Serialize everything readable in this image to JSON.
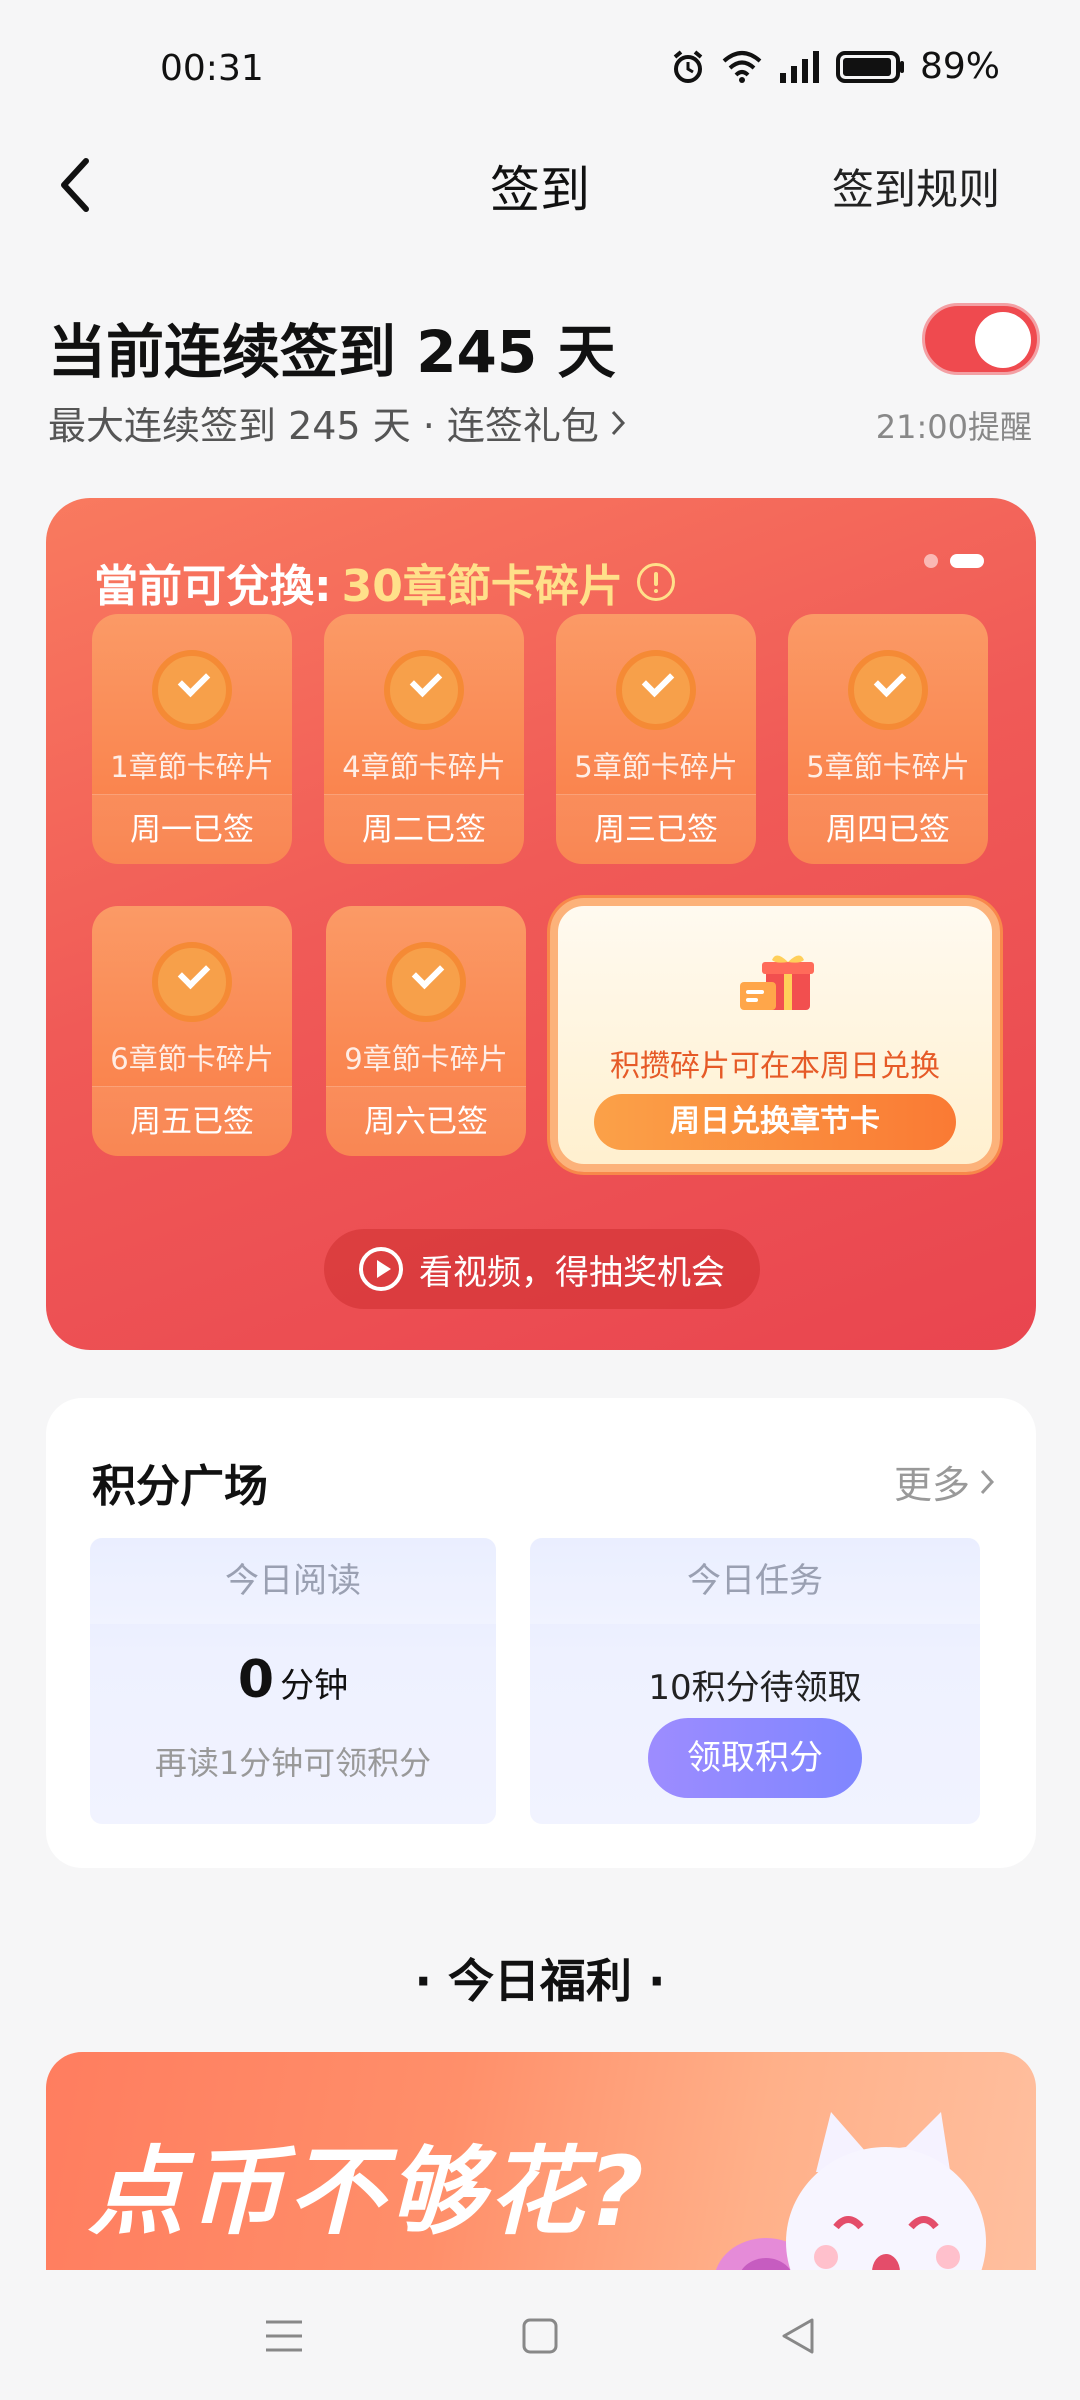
{
  "status_bar": {
    "time": "00:31",
    "battery": "89%",
    "icons": [
      "alarm-icon",
      "wifi-icon",
      "signal-icon",
      "battery-icon"
    ]
  },
  "nav": {
    "title": "签到",
    "rules_label": "签到规则",
    "back_icon": "back-arrow-icon"
  },
  "streak": {
    "title": "当前连续签到 245 天",
    "subtitle": "最大连续签到 245 天 · 连签礼包",
    "reminder_on": true,
    "reminder_label": "21:00提醒"
  },
  "exchange": {
    "label": "當前可兌換:",
    "value": "30章節卡碎片",
    "page_count": 2,
    "active_page": 2,
    "days": [
      {
        "reward": "1章節卡碎片",
        "status": "周一已签"
      },
      {
        "reward": "4章節卡碎片",
        "status": "周二已签"
      },
      {
        "reward": "5章節卡碎片",
        "status": "周三已签"
      },
      {
        "reward": "5章節卡碎片",
        "status": "周四已签"
      },
      {
        "reward": "6章節卡碎片",
        "status": "周五已签"
      },
      {
        "reward": "9章節卡碎片",
        "status": "周六已签"
      }
    ],
    "sunday": {
      "text": "积攒碎片可在本周日兑换",
      "button": "周日兑换章节卡"
    },
    "video_button": "看视频，得抽奖机会"
  },
  "plaza": {
    "title": "积分广场",
    "more": "更多",
    "reading": {
      "head": "今日阅读",
      "value": "0",
      "unit": "分钟",
      "hint": "再读1分钟可领积分"
    },
    "task": {
      "head": "今日任务",
      "value": "10积分待领取",
      "button": "领取积分"
    }
  },
  "welfare": {
    "title": "· 今日福利 ·",
    "banner_text": "点币不够花?"
  },
  "colors": {
    "accent_red": "#ef4a4f",
    "highlight_yellow": "#ffe08a",
    "claim_purple": "#8f88ff"
  }
}
